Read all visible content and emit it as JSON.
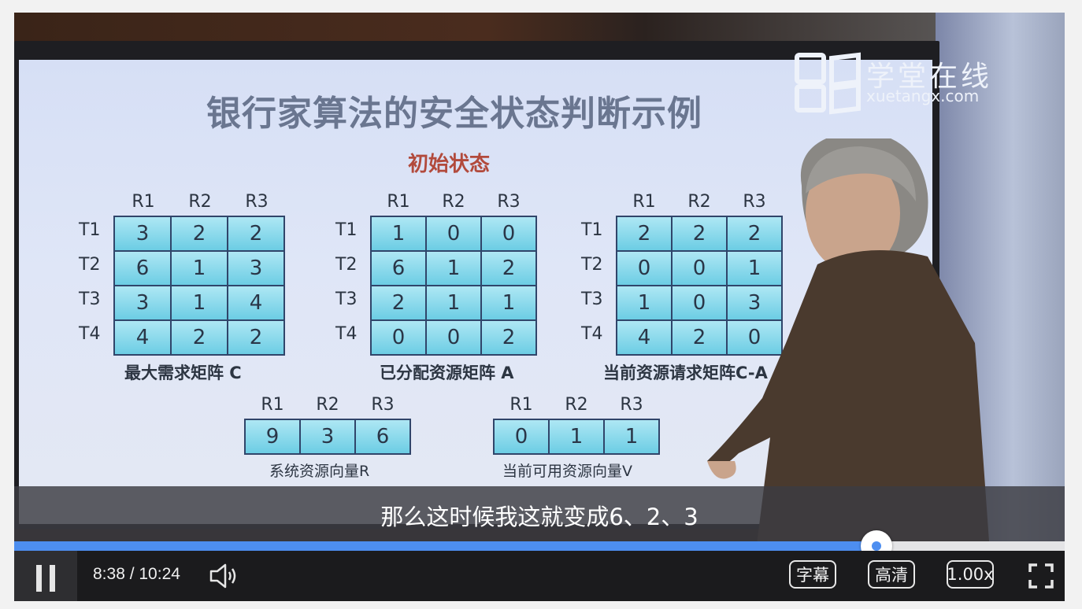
{
  "slide": {
    "title": "银行家算法的安全状态判断示例",
    "subtitle": "初始状态",
    "logo_cn": "学堂在线",
    "logo_en": "xuetangx.com"
  },
  "matrices": {
    "max_demand": {
      "caption": "最大需求矩阵 C",
      "cols": [
        "R1",
        "R2",
        "R3"
      ],
      "rows": [
        "T1",
        "T2",
        "T3",
        "T4"
      ],
      "values": [
        [
          "3",
          "2",
          "2"
        ],
        [
          "6",
          "1",
          "3"
        ],
        [
          "3",
          "1",
          "4"
        ],
        [
          "4",
          "2",
          "2"
        ]
      ]
    },
    "allocated": {
      "caption": "已分配资源矩阵 A",
      "cols": [
        "R1",
        "R2",
        "R3"
      ],
      "rows": [
        "T1",
        "T2",
        "T3",
        "T4"
      ],
      "values": [
        [
          "1",
          "0",
          "0"
        ],
        [
          "6",
          "1",
          "2"
        ],
        [
          "2",
          "1",
          "1"
        ],
        [
          "0",
          "0",
          "2"
        ]
      ]
    },
    "request": {
      "caption": "当前资源请求矩阵C-A",
      "cols": [
        "R1",
        "R2",
        "R3"
      ],
      "rows": [
        "T1",
        "T2",
        "T3",
        "T4"
      ],
      "values": [
        [
          "2",
          "2",
          "2"
        ],
        [
          "0",
          "0",
          "1"
        ],
        [
          "1",
          "0",
          "3"
        ],
        [
          "4",
          "2",
          "0"
        ]
      ]
    },
    "system": {
      "caption": "系统资源向量R",
      "cols": [
        "R1",
        "R2",
        "R3"
      ],
      "values": [
        [
          "9",
          "3",
          "6"
        ]
      ]
    },
    "available": {
      "caption": "当前可用资源向量V",
      "cols": [
        "R1",
        "R2",
        "R3"
      ],
      "values": [
        [
          "0",
          "1",
          "1"
        ]
      ]
    }
  },
  "subtitle_text": "那么这时候我这就变成6、2、3",
  "player": {
    "time_display": "8:38 / 10:24",
    "progress_fraction": 0.821,
    "subtitles_label": "字幕",
    "quality_label": "高清",
    "speed_label": "1.00x",
    "accent_color": "#4d8ef0"
  }
}
